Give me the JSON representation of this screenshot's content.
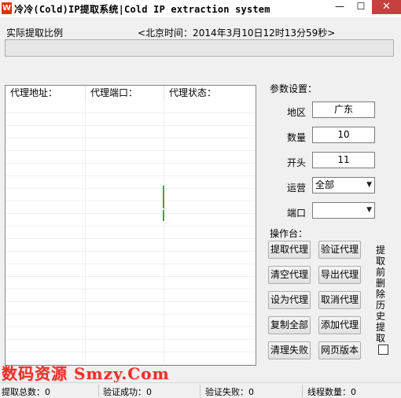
{
  "window": {
    "title": "冷冷(Cold)IP提取系统|Cold IP extraction system",
    "minimize": "—",
    "maximize": "☐",
    "close": "✕"
  },
  "header": {
    "ratio_label": "实际提取比例",
    "clock": "<北京时间：2014年3月10日12时13分59秒>",
    "progress": 0
  },
  "list": {
    "columns": [
      "代理地址：",
      "代理端口：",
      "代理状态："
    ]
  },
  "params": {
    "title": "参数设置：",
    "region_label": "地区",
    "region_value": "广东",
    "count_label": "数量",
    "count_value": "10",
    "prefix_label": "开头",
    "prefix_value": "11",
    "carrier_label": "运营",
    "carrier_value": "全部",
    "port_label": "端口",
    "port_value": ""
  },
  "ops": {
    "title": "操作台：",
    "buttons": [
      "提取代理",
      "验证代理",
      "清空代理",
      "导出代理",
      "设为代理",
      "取消代理",
      "复制全部",
      "添加代理",
      "清理失败",
      "网页版本"
    ],
    "side_label": "提取前删除历史提取"
  },
  "watermark": "数码资源 Smzy.Com",
  "status": {
    "total": "提取总数：0",
    "verified_ok": "验证成功：0",
    "verified_fail": "验证失败：0",
    "threads": "线程数量：0"
  }
}
